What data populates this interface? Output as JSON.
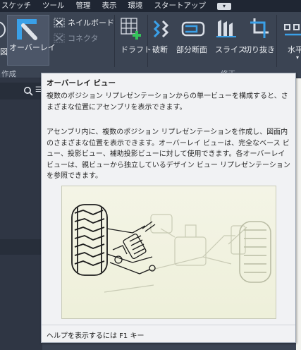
{
  "menu": {
    "items": [
      "スケッチ",
      "ツール",
      "管理",
      "表示",
      "環境",
      "スタートアップ"
    ],
    "overflow_icon": "chevron-down-icon"
  },
  "ribbon": {
    "panel_create_title": "作成",
    "panel_modify_title": "修正",
    "overlay_label": "オーバーレイ",
    "nailboard_label": "ネイルボード",
    "connector_label": "コネクタ",
    "draft_label": "ドラフト",
    "break_label": "破断",
    "partial_section_label": "部分断面",
    "slice_label": "スライス",
    "crop_label": "切り抜き",
    "horizontal_label": "水平",
    "left_cut_label": "図"
  },
  "browser": {
    "search_icon": "search-icon",
    "menu_icon": "menu-icon",
    "menu_glyph": "☰"
  },
  "tooltip": {
    "title": "オーバーレイ ビュー",
    "paragraph1": "複数のポジション リプレゼンテーションからの単一ビューを構成すると、さまざまな位置にアセンブリを表示できます。",
    "paragraph2": "アセンブリ内に、複数のポジション リプレゼンテーションを作成し、図面内のさまざまな位置を表示できます。オーバーレイ ビューは、完全なベース ビュー、投影ビュー、補助投影ビューに対して使用できます。各オーバーレイ ビューは、親ビューから独立しているデザイン ビュー リプレゼンテーションを参照できます。",
    "help_text": "ヘルプを表示するには F1 キー"
  },
  "colors": {
    "menubar_bg": "#1f2633",
    "ribbon_bg": "#3b4453",
    "tooltip_bg": "#f1f2f4",
    "accent_blue": "#3aa0e8"
  }
}
